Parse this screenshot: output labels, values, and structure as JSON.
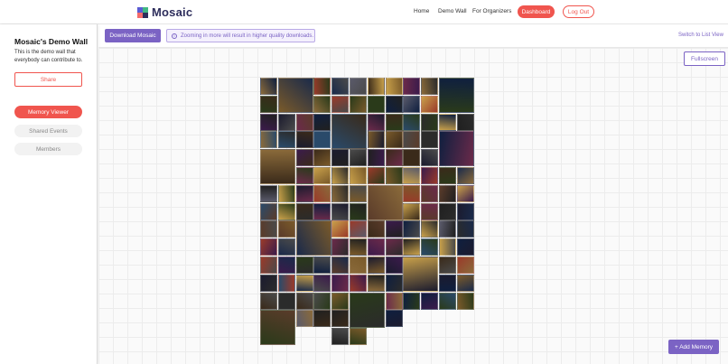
{
  "app": {
    "logo_text": "Mosaic"
  },
  "nav": {
    "home": "Home",
    "demo_wall": "Demo Wall",
    "organizers": "For Organizers",
    "dashboard": "Dashboard",
    "logout": "Log Out"
  },
  "sidebar": {
    "title": "Mosaic's Demo Wall",
    "description": "This is the demo wall that everybody can contribute to.",
    "share": "Share",
    "items": [
      {
        "label": "Memory Viewer",
        "active": true
      },
      {
        "label": "Shared Events",
        "active": false
      },
      {
        "label": "Members",
        "active": false
      }
    ]
  },
  "toolbar": {
    "download": "Download Mosaic",
    "zoom_note": "Zooming in more will result in higher quality downloads.",
    "switch_view": "Switch to List View",
    "fullscreen": "Fullscreen",
    "add_memory": "+ Add Memory"
  },
  "colors": {
    "accent": "#7b63c4",
    "primary": "#f0554e"
  },
  "icons": {
    "info": "info-icon",
    "logo": "mosaic-logo-icon"
  }
}
